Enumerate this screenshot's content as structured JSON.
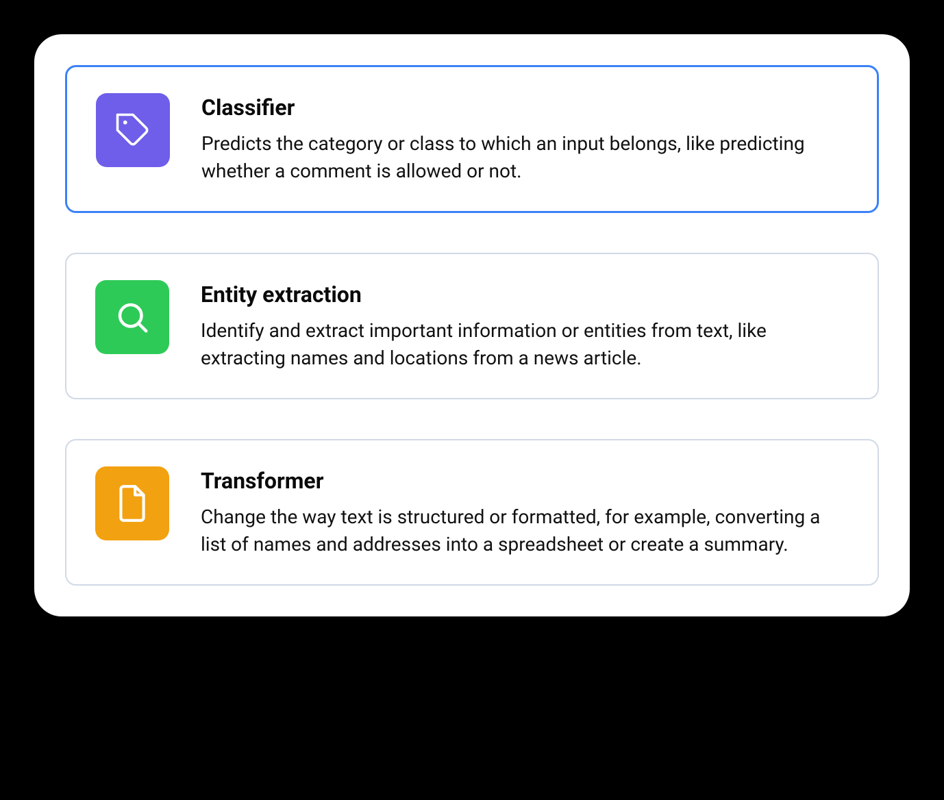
{
  "options": [
    {
      "title": "Classifier",
      "description": "Predicts the category or class to which an input belongs, like predicting whether a comment is allowed or not.",
      "icon": "tag-icon",
      "color": "purple",
      "selected": true
    },
    {
      "title": "Entity extraction",
      "description": "Identify and extract important information or entities from text, like extracting names and locations from a news article.",
      "icon": "search-icon",
      "color": "green",
      "selected": false
    },
    {
      "title": "Transformer",
      "description": "Change the way text is structured or formatted, for example, converting a list of names and addresses into a spreadsheet or create a summary.",
      "icon": "file-icon",
      "color": "orange",
      "selected": false
    }
  ],
  "colors": {
    "purple": "#6e5ee9",
    "green": "#2eca58",
    "orange": "#f2a110",
    "selected_border": "#3b82f6"
  }
}
